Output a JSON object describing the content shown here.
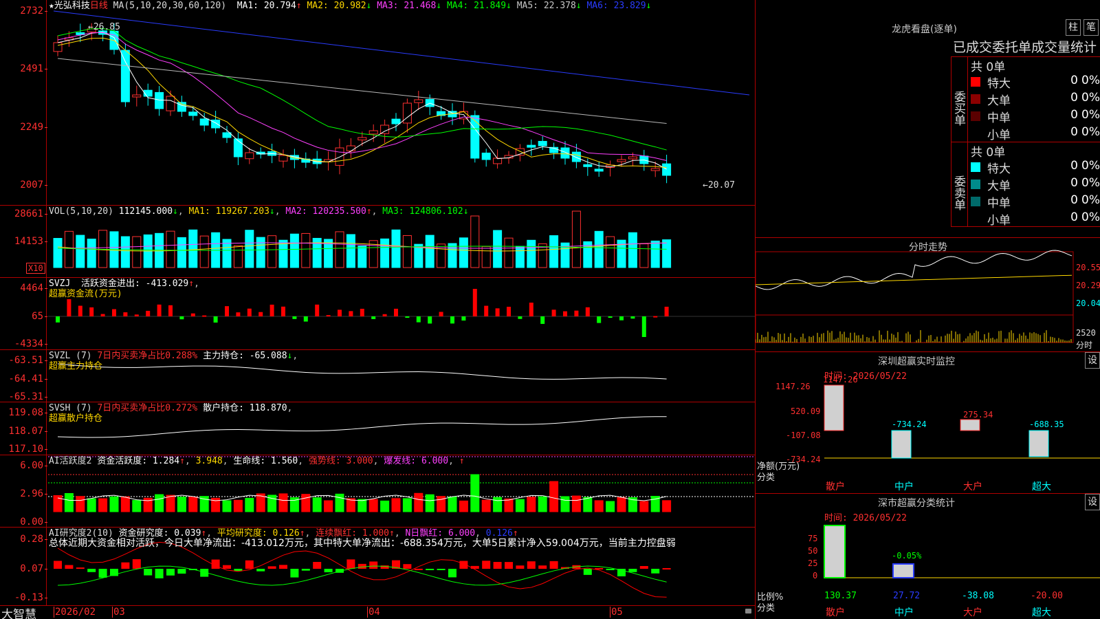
{
  "stock": {
    "name": "★光弘科技",
    "period": "日线"
  },
  "kline": {
    "yaxis": [
      "2732",
      "2491",
      "2249",
      "2007"
    ],
    "ma_header": "MA(5,10,20,30,60,120)",
    "ma_values": [
      {
        "label": "MA1: 20.794",
        "arrow": "↑",
        "color": "#ffffff"
      },
      {
        "label": "MA2: 20.982",
        "arrow": "↓",
        "color": "#ffd800"
      },
      {
        "label": "MA3: 21.468",
        "arrow": "↓",
        "color": "#ff40ff"
      },
      {
        "label": "MA4: 21.849",
        "arrow": "↓",
        "color": "#00ff00"
      },
      {
        "label": "MA5: 22.378",
        "arrow": "↓",
        "color": "#c8c8c8"
      },
      {
        "label": "MA6: 23.829",
        "arrow": "↓",
        "color": "#2a3cff"
      }
    ],
    "high_label": "26.85",
    "low_label": "20.07"
  },
  "vol": {
    "yaxis": [
      "28661",
      "14153"
    ],
    "unit": "X10",
    "header": "VOL(5,10,20)",
    "v": "112145.000",
    "ma1": "MA1: 119267.203",
    "ma2": "MA2: 120235.500",
    "ma3": "MA3: 124806.102"
  },
  "svzj": {
    "yaxis": [
      "4464",
      "65",
      "-4334"
    ],
    "header": "SVZJ  活跃资金进出: -413.029",
    "arrow": "↑",
    "sub": "超赢资金流(万元)"
  },
  "svzl": {
    "yaxis": [
      "-63.51",
      "-64.41",
      "-65.31"
    ],
    "header_a": "SVZL (7)",
    "header_b": "7日内买卖净占比0.288%",
    "header_c": "主力持仓: -65.088",
    "arrow": "↓",
    "sub": "超赢主力持仓"
  },
  "svsh": {
    "yaxis": [
      "119.08",
      "118.07",
      "117.10"
    ],
    "header_a": "SVSH (7)",
    "header_b": "7日内买卖净占比0.272%",
    "header_c": "散户持仓: 118.870",
    "sub": "超赢散户持仓"
  },
  "aihyd": {
    "yaxis": [
      "6.00",
      "2.96",
      "0.00"
    ],
    "header_a": "AI活跃度2",
    "header_b": "资金活跃度: 1.284",
    "header_c": "3.948",
    "header_d": "生命线: 1.560",
    "header_e": "强势线: 3.000",
    "header_f": "爆发线: 6.000"
  },
  "aiyjd": {
    "yaxis": [
      "0.28",
      "0.07",
      "-0.13"
    ],
    "header_a": "AI研究度2(10)",
    "header_b": "资金研究度: 0.039",
    "header_c": "平均研究度: 0.126",
    "header_d": "连续飘红: 1.000",
    "header_e": "N日飘红: 6.000",
    "header_f": "0.126",
    "summary": "总体近期大资金相对活跃，今日大单净流出：-413.012万元，其中特大单净流出：-688.354万元，大单5日累计净入59.004万元，当前主力控盘弱"
  },
  "bottom": {
    "brand": "大智慧",
    "labels": [
      "2026/02",
      "03",
      "04",
      "05"
    ]
  },
  "lhkp": {
    "title": "龙虎看盘(逐单)",
    "btn1": "柱",
    "btn2": "笔",
    "subtitle": "已成交委托单成交量统计",
    "buy": {
      "side": "委买单",
      "total": "共 0单",
      "rows": [
        {
          "label": "特大",
          "val": "0",
          "pct": "0%",
          "color": "#ff0000"
        },
        {
          "label": "大单",
          "val": "0",
          "pct": "0%",
          "color": "#8c0000"
        },
        {
          "label": "中单",
          "val": "0",
          "pct": "0%",
          "color": "#5a0000"
        },
        {
          "label": "小单",
          "val": "0",
          "pct": "0%",
          "color": "#000000"
        }
      ]
    },
    "sell": {
      "side": "委卖单",
      "total": "共 0单",
      "rows": [
        {
          "label": "特大",
          "val": "0",
          "pct": "0%",
          "color": "#00ffff"
        },
        {
          "label": "大单",
          "val": "0",
          "pct": "0%",
          "color": "#008c8c"
        },
        {
          "label": "中单",
          "val": "0",
          "pct": "0%",
          "color": "#006a6a"
        },
        {
          "label": "小单",
          "val": "0",
          "pct": "0%",
          "color": "#000000"
        }
      ]
    }
  },
  "fenshi": {
    "title": "分时走势",
    "yaxis": [
      "20.55",
      "20.29",
      "20.04",
      "2520",
      "分时"
    ]
  },
  "szjk": {
    "title": "深圳超赢实时监控",
    "btn": "设",
    "time": "时间: 2026/05/22",
    "yaxis": [
      "1147.26",
      "520.09",
      "-107.08",
      "-734.24"
    ],
    "ylabel": "净额(万元)",
    "xlabel": "分类",
    "cats": [
      "散户",
      "中户",
      "大户",
      "超大"
    ],
    "vals": [
      "1147.26",
      "-734.24",
      "275.34",
      "-688.35"
    ]
  },
  "sfltj": {
    "title": "深市超赢分类统计",
    "btn": "设",
    "time": "时间: 2026/05/22",
    "yaxis": [
      "75",
      "50",
      "25",
      "0"
    ],
    "ylabel": "比例%",
    "xlabel": "分类",
    "cats": [
      "散户",
      "中户",
      "大户",
      "超大"
    ],
    "vals": [
      "130.37",
      "27.72",
      "-38.08",
      "-20.00"
    ],
    "note": "-0.05%"
  }
}
